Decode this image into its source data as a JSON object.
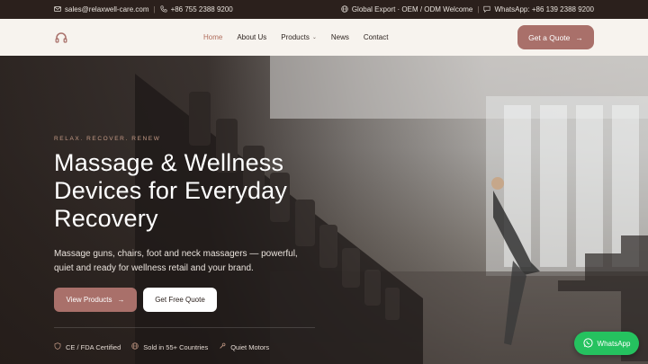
{
  "topbar": {
    "email": "sales@relaxwell-care.com",
    "phone": "+86 755 2388 9200",
    "export_note": "Global Export · OEM / ODM Welcome",
    "whatsapp": "WhatsApp: +86 139 2388 9200"
  },
  "nav": {
    "items": [
      {
        "label": "Home",
        "active": true
      },
      {
        "label": "About Us"
      },
      {
        "label": "Products",
        "dropdown": true
      },
      {
        "label": "News"
      },
      {
        "label": "Contact"
      }
    ],
    "cta_label": "Get a Quote"
  },
  "hero": {
    "eyebrow": "RELAX. RECOVER. RENEW",
    "headline": "Massage & Wellness Devices for Everyday Recovery",
    "subtitle": "Massage guns, chairs, foot and neck massagers — powerful, quiet and ready for wellness retail and your brand.",
    "primary_button": "View Products",
    "secondary_button": "Get Free Quote",
    "features": [
      {
        "label": "CE / FDA Certified",
        "icon": "shield-icon"
      },
      {
        "label": "Sold in 55+ Countries",
        "icon": "globe-icon"
      },
      {
        "label": "Quiet Motors",
        "icon": "wrench-icon"
      }
    ]
  },
  "whatsapp_button": {
    "label": "WhatsApp"
  },
  "colors": {
    "accent": "#a9706a",
    "topbar_bg": "#2b201c",
    "nav_bg": "#f7f3ee",
    "whatsapp_green": "#25c25f"
  }
}
